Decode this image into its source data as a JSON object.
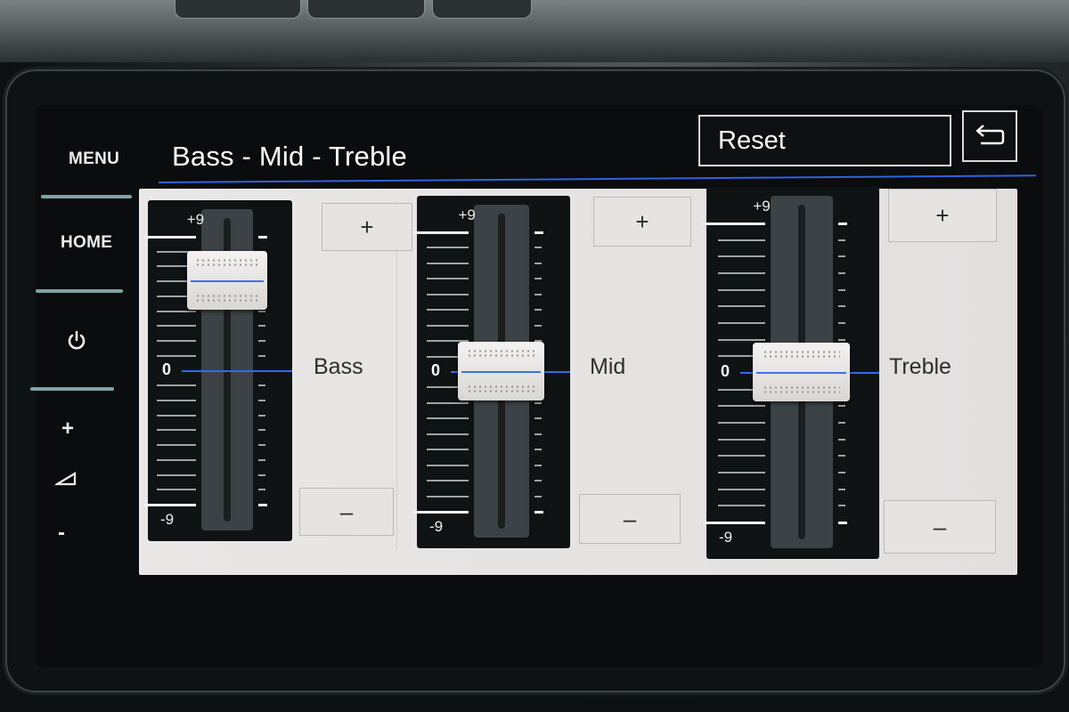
{
  "sidebar": {
    "menu_label": "MENU",
    "home_label": "HOME",
    "power_icon": "power-icon",
    "volume_up_label": "+",
    "volume_icon": "volume-icon",
    "volume_down_label": "-"
  },
  "header": {
    "title": "Bass - Mid - Treble",
    "reset_label": "Reset",
    "back_icon": "back-arrow-icon"
  },
  "equalizer": {
    "scale_max_label": "+9",
    "scale_min_label": "-9",
    "zero_label": "0",
    "range": [
      -9,
      9
    ],
    "plus_label": "+",
    "minus_label": "–",
    "bands": [
      {
        "name": "Bass",
        "value": 6
      },
      {
        "name": "Mid",
        "value": 0
      },
      {
        "name": "Treble",
        "value": 0
      }
    ]
  },
  "colors": {
    "accent_blue": "#2f63e0",
    "panel_bg": "#e9e7e6",
    "screen_bg": "#0a0c0d"
  }
}
